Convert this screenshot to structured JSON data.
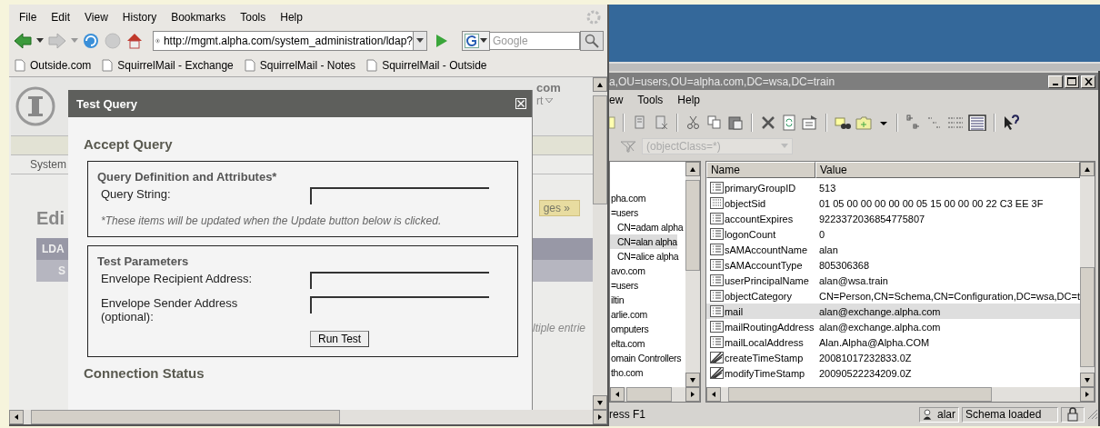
{
  "browser": {
    "menu": [
      "File",
      "Edit",
      "View",
      "History",
      "Bookmarks",
      "Tools",
      "Help"
    ],
    "address": "http://mgmt.alpha.com/system_administration/ldap?",
    "search": {
      "placeholder": "Google"
    },
    "bookmarks": [
      "Outside.com",
      "SquirrelMail - Exchange",
      "SquirrelMail - Notes",
      "SquirrelMail - Outside"
    ],
    "page": {
      "header_fragments": [
        "com",
        "rt"
      ],
      "nav_item": "System",
      "heading": "Edi",
      "action_button": "ges »",
      "table_header": "LDA",
      "table_subheader": "S",
      "note": "ltiple entrie"
    }
  },
  "dialog": {
    "title": "Test Query",
    "heading": "Accept Query",
    "sections": [
      {
        "title": "Query Definition and Attributes*",
        "fields": [
          {
            "label": "Query String:"
          }
        ],
        "note": "*These items will be updated when the Update button below is clicked."
      },
      {
        "title": "Test Parameters",
        "fields": [
          {
            "label": "Envelope Recipient Address:"
          },
          {
            "label": "Envelope Sender Address (optional):"
          }
        ],
        "button": "Run Test"
      }
    ],
    "footer_heading": "Connection Status"
  },
  "adsi": {
    "title": "a,OU=users,OU=alpha.com,DC=wsa,DC=train",
    "menu": [
      "ew",
      "Tools",
      "Help"
    ],
    "filter": "(objectClass=*)",
    "tree": [
      {
        "label": "pha.com",
        "selected": false
      },
      {
        "label": "=users",
        "selected": false,
        "children": [
          {
            "label": "CN=adam alpha",
            "selected": false
          },
          {
            "label": "CN=alan alpha",
            "selected": true
          },
          {
            "label": "CN=alice alpha",
            "selected": false
          }
        ]
      },
      {
        "label": "avo.com",
        "selected": false
      },
      {
        "label": "=users",
        "selected": false
      },
      {
        "label": "iltin",
        "selected": false
      },
      {
        "label": "arlie.com",
        "selected": false
      },
      {
        "label": "omputers",
        "selected": false
      },
      {
        "label": "elta.com",
        "selected": false
      },
      {
        "label": "omain Controllers",
        "selected": false
      },
      {
        "label": "tho.com",
        "selected": false
      }
    ],
    "columns": [
      "Name",
      "Value"
    ],
    "rows": [
      {
        "name": "primaryGroupID",
        "value": "513",
        "kind": "string",
        "selected": false
      },
      {
        "name": "objectSid",
        "value": "01 05 00 00 00 00 00 05 15 00 00 00 22 C3 EE 3F",
        "kind": "binary",
        "selected": false
      },
      {
        "name": "accountExpires",
        "value": "9223372036854775807",
        "kind": "string",
        "selected": false
      },
      {
        "name": "logonCount",
        "value": "0",
        "kind": "string",
        "selected": false
      },
      {
        "name": "sAMAccountName",
        "value": "alan",
        "kind": "string",
        "selected": false
      },
      {
        "name": "sAMAccountType",
        "value": "805306368",
        "kind": "string",
        "selected": false
      },
      {
        "name": "userPrincipalName",
        "value": "alan@wsa.train",
        "kind": "string",
        "selected": false
      },
      {
        "name": "objectCategory",
        "value": "CN=Person,CN=Schema,CN=Configuration,DC=wsa,DC=t",
        "kind": "string",
        "selected": false
      },
      {
        "name": "mail",
        "value": "alan@exchange.alpha.com",
        "kind": "string",
        "selected": true
      },
      {
        "name": "mailRoutingAddress",
        "value": "alan@exchange.alpha.com",
        "kind": "string",
        "selected": false
      },
      {
        "name": "mailLocalAddress",
        "value": "Alan.Alpha@Alpha.COM",
        "kind": "string",
        "selected": false
      },
      {
        "name": "createTimeStamp",
        "value": "20081017232833.0Z",
        "kind": "time",
        "selected": false
      },
      {
        "name": "modifyTimeStamp",
        "value": "20090522234209.0Z",
        "kind": "time",
        "selected": false
      }
    ],
    "status": {
      "hint": "ress F1",
      "user": "alar",
      "message": "Schema loaded"
    }
  }
}
